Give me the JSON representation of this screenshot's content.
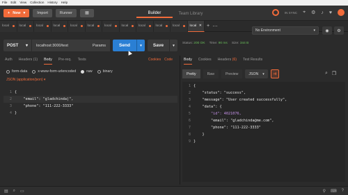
{
  "menu": [
    "File",
    "Edit",
    "View",
    "Collection",
    "History",
    "Help"
  ],
  "toolbar": {
    "new_label": "New",
    "import_label": "Import",
    "runner_label": "Runner",
    "builder_label": "Builder",
    "team_library_label": "Team Library",
    "sync_label": "IN SYNC"
  },
  "tabs": [
    {
      "label": "local"
    },
    {
      "label": "local"
    },
    {
      "label": "local"
    },
    {
      "label": "local"
    },
    {
      "label": "local"
    },
    {
      "label": "local"
    },
    {
      "label": "local"
    },
    {
      "label": "local"
    },
    {
      "label": "local"
    },
    {
      "label": "local"
    },
    {
      "label": "local"
    },
    {
      "label": "local",
      "active": true
    }
  ],
  "environment": {
    "selected": "No Environment"
  },
  "request": {
    "method": "POST",
    "url": "localhost:3000/test",
    "params_label": "Params",
    "send_label": "Send",
    "save_label": "Save"
  },
  "response_status": {
    "status_label": "Status:",
    "status_value": "200 OK",
    "time_label": "Time:",
    "time_value": "90 ms",
    "size_label": "Size:",
    "size_value": "344 B"
  },
  "request_tabs": {
    "auth": "Auth",
    "headers": "Headers",
    "headers_count": "(1)",
    "body": "Body",
    "prerequest": "Pre-req.",
    "tests": "Tests",
    "cookies": "Cookies",
    "code": "Code"
  },
  "response_tabs": {
    "body": "Body",
    "cookies": "Cookies",
    "headers": "Headers",
    "headers_count": "(6)",
    "test_results": "Test Results"
  },
  "body_modes": {
    "form_data": "form-data",
    "urlencoded": "x-www-form-urlencoded",
    "raw": "raw",
    "binary": "binary",
    "selected": "raw",
    "content_type": "JSON (application/json)"
  },
  "request_body_lines": [
    {
      "n": "1",
      "text": "{"
    },
    {
      "n": "2",
      "text": "    \"email\": \"gladchinda|\","
    },
    {
      "n": "3",
      "text": "    \"phone\": \"111-222-3333\""
    },
    {
      "n": "4",
      "text": "}"
    }
  ],
  "response_view": {
    "pretty": "Pretty",
    "raw": "Raw",
    "preview": "Preview",
    "format": "JSON"
  },
  "response_body_lines": [
    {
      "n": "1",
      "text": "{"
    },
    {
      "n": "2",
      "text": "    \"status\": \"success\","
    },
    {
      "n": "3",
      "text": "    \"message\": \"User created successfully\","
    },
    {
      "n": "4",
      "text": "    \"data\": {"
    },
    {
      "n": "5",
      "text": "        \"id\": 4021076,"
    },
    {
      "n": "6",
      "text": "        \"email\": \"gladchinda@me.com\","
    },
    {
      "n": "7",
      "text": "        \"phone\": \"111-222-3333\""
    },
    {
      "n": "8",
      "text": "    }"
    },
    {
      "n": "9",
      "text": "}"
    }
  ],
  "colors": {
    "accent": "#f26b3a",
    "send": "#2a7fd4",
    "ok": "#6abf5a"
  }
}
